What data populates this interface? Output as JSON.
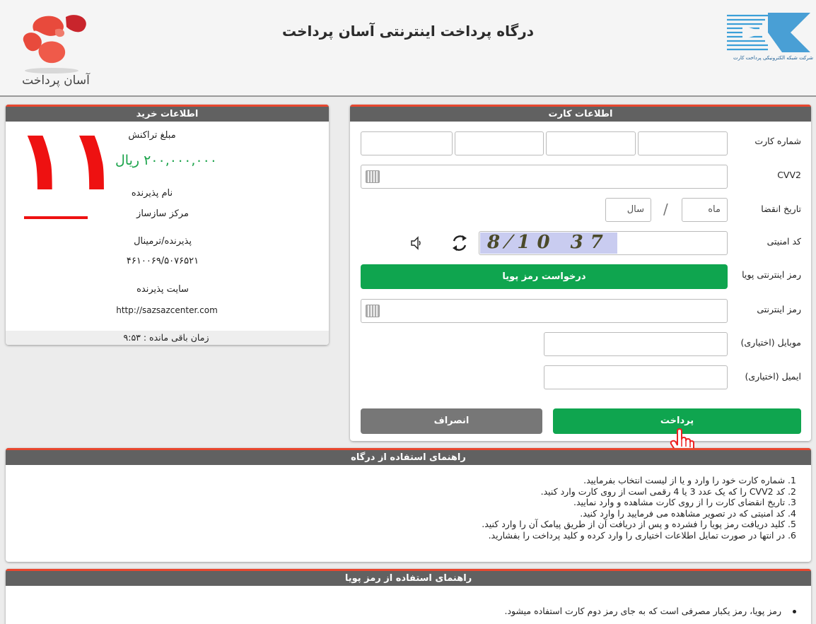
{
  "header": {
    "title": "درگاه پرداخت اینترنتی آسان پرداخت",
    "logo_left_text": "آسان پرداخت",
    "logo_right_text": "شرکت شبکه الکترونیکی پرداخت کارت"
  },
  "card_info": {
    "title": "اطلاعات کارت",
    "card_number_label": "شماره کارت",
    "cvv2_label": "CVV2",
    "expiry_label": "تاریخ انقضا",
    "month_placeholder": "ماه",
    "year_placeholder": "سال",
    "slash": "/",
    "captcha_label": "کد امنیتی",
    "captcha_value": "8⁄10 37",
    "dynamic_pin_label": "رمز اینترنتی پویا",
    "dynamic_pin_button": "درخواست رمز پویا",
    "internet_pin_label": "رمز اینترنتی",
    "mobile_label": "موبایل (اختیاری)",
    "email_label": "ایمیل (اختیاری)",
    "pay_button": "پرداخت",
    "cancel_button": "انصراف"
  },
  "purchase_info": {
    "title": "اطلاعات خرید",
    "amount_label": "مبلغ تراکنش",
    "amount_value": "۲۰۰,۰۰۰,۰۰۰ ریال",
    "merchant_label": "نام پذیرنده",
    "merchant_value": "مرکز سازساز",
    "terminal_label": "پذیرنده/ترمینال",
    "terminal_value": "۴۶۱۰۰۶۹/۵۰۷۶۵۲۱",
    "site_label": "سایت پذیرنده",
    "site_value": "http://sazsazcenter.com",
    "timer": "زمان باقی مانده : ۹:۵۳",
    "big_number": "۱۱"
  },
  "gateway_guide": {
    "title": "راهنمای استفاده از درگاه",
    "items": [
      "1. شماره کارت خود را وارد و یا از لیست انتخاب بفرمایید.",
      "2. کد CVV2 را که یک عدد 3 یا 4 رقمی است از روی کارت وارد کنید.",
      "3. تاریخ انقضای کارت را از روی کارت مشاهده و وارد نمایید.",
      "4. کد امنیتی که در تصویر مشاهده می فرمایید را وارد کنید.",
      "5. کلید دریافت رمز پویا را فشرده و پس از دریافت آن از طریق پیامک آن را وارد کنید.",
      "6. در انتها در صورت تمایل اطلاعات اختیاری را وارد کرده و کلید پرداخت را بفشارید."
    ]
  },
  "dynamic_guide": {
    "title": "راهنمای استفاده از رمز پویا",
    "items": [
      "رمز پویا، رمز یکبار مصرفی است که به جای رمز دوم کارت استفاده میشود."
    ]
  },
  "colors": {
    "accent_red": "#e8472f",
    "green": "#0fa54f",
    "header_gray": "#616161"
  }
}
